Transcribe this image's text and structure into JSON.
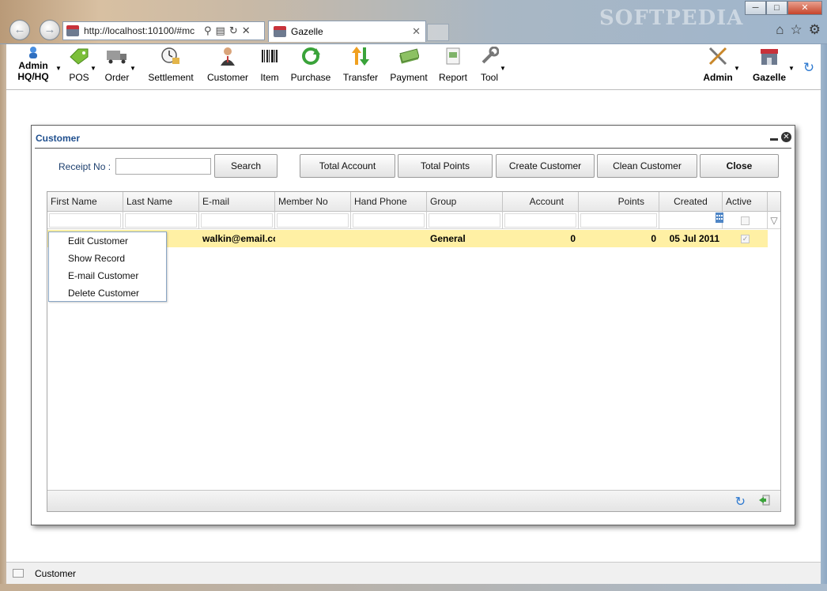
{
  "browser": {
    "url": "http://localhost:10100/#mc",
    "tab_title": "Gazelle",
    "watermark": "SOFTPEDIA"
  },
  "toolbar": {
    "user_line1": "Admin",
    "user_line2": "HQ/HQ",
    "items": [
      "POS",
      "Order",
      "Settlement",
      "Customer",
      "Item",
      "Purchase",
      "Transfer",
      "Payment",
      "Report",
      "Tool"
    ],
    "right_admin": "Admin",
    "right_store": "Gazelle"
  },
  "window": {
    "title": "Customer",
    "receipt_label": "Receipt No :",
    "receipt_value": "",
    "buttons": {
      "search": "Search",
      "total_account": "Total Account",
      "total_points": "Total Points",
      "create_customer": "Create Customer",
      "clean_customer": "Clean Customer",
      "close": "Close"
    }
  },
  "grid": {
    "columns": [
      "First Name",
      "Last Name",
      "E-mail",
      "Member No",
      "Hand Phone",
      "Group",
      "Account",
      "Points",
      "Created",
      "Active"
    ],
    "rows": [
      {
        "first_name": "",
        "last_name": "",
        "email": "walkin@email.com",
        "member_no": "",
        "hand_phone": "",
        "group": "General",
        "account": "0",
        "points": "0",
        "created": "05 Jul 2011",
        "active": true
      }
    ]
  },
  "context_menu": {
    "items": [
      "Edit Customer",
      "Show Record",
      "E-mail Customer",
      "Delete Customer"
    ]
  },
  "status_bar": {
    "text": "Customer"
  }
}
